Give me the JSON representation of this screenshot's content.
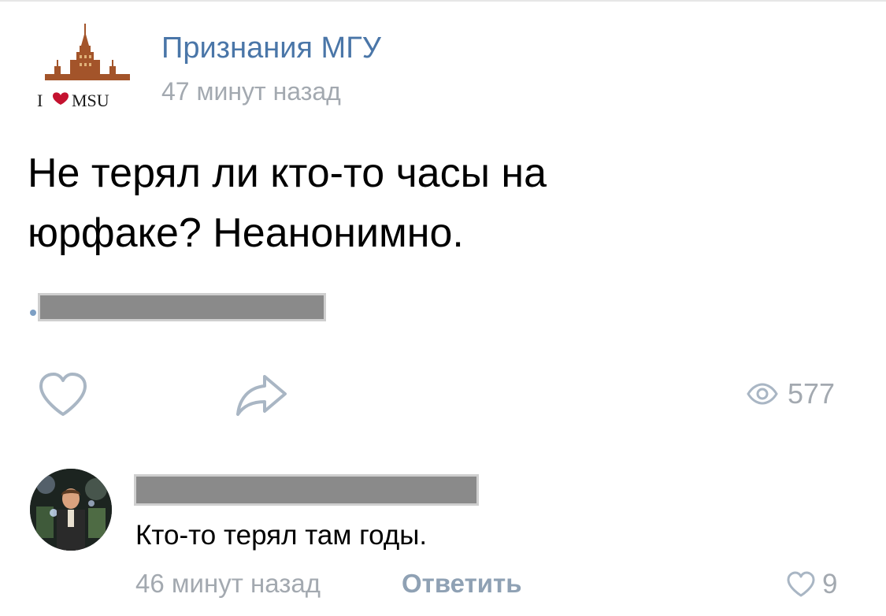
{
  "post": {
    "group_name": "Признания МГУ",
    "time": "47 минут назад",
    "logo_text": "I MSU",
    "text_line1": "Не терял ли кто-то часы на",
    "text_line2": "юрфаке? Неанонимно.",
    "views": "577"
  },
  "comment": {
    "text": "Кто-то терял там годы.",
    "time": "46 минут назад",
    "reply_label": "Ответить",
    "likes": "9"
  },
  "colors": {
    "link_blue": "#4a76a8",
    "muted_gray": "#a3a9b0",
    "icon_gray": "#a9b6c4",
    "heart_red": "#c4122f",
    "logo_brown": "#a3542a"
  },
  "icons": {
    "like": "heart-outline-icon",
    "share": "share-arrow-icon",
    "views": "eye-icon",
    "comment_like": "heart-outline-icon"
  }
}
